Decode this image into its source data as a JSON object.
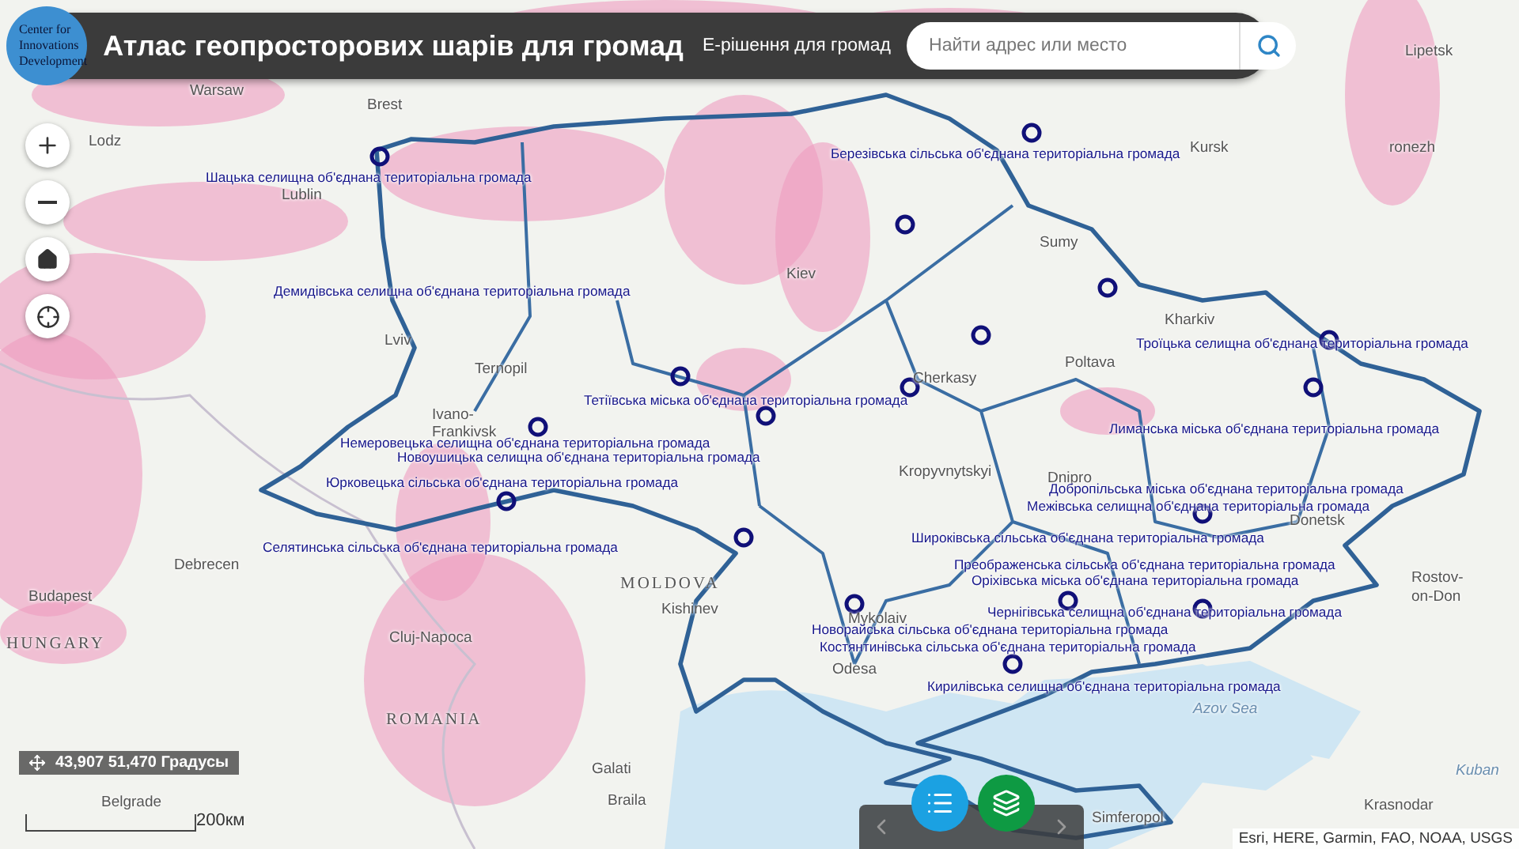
{
  "header": {
    "logo_lines": [
      "Center for",
      "Innovations",
      "Development"
    ],
    "title": "Атлас геопросторових шарів для громад",
    "subtitle": "Е-рішення для громад",
    "search": {
      "placeholder": "Найти адрес или место"
    }
  },
  "map_controls": [
    {
      "kind": "zoom-in"
    },
    {
      "kind": "zoom-out"
    },
    {
      "kind": "home"
    },
    {
      "kind": "locate"
    }
  ],
  "place_labels": [
    {
      "text": "Warsaw",
      "kind": "city"
    },
    {
      "text": "Brest",
      "kind": "city"
    },
    {
      "text": "Lodz",
      "kind": "city"
    },
    {
      "text": "Lublin",
      "kind": "city"
    },
    {
      "text": "Lipetsk",
      "kind": "city"
    },
    {
      "text": "Kursk",
      "kind": "city"
    },
    {
      "text": "ronezh",
      "kind": "city"
    },
    {
      "text": "Kiev",
      "kind": "city"
    },
    {
      "text": "Sumy",
      "kind": "city"
    },
    {
      "text": "Kharkiv",
      "kind": "city"
    },
    {
      "text": "Lviv",
      "kind": "city"
    },
    {
      "text": "Ternopil",
      "kind": "city"
    },
    {
      "text": "Ivano-",
      "kind": "city"
    },
    {
      "text": "Frankivsk",
      "kind": "city"
    },
    {
      "text": "Cherkasy",
      "kind": "city"
    },
    {
      "text": "Poltava",
      "kind": "city"
    },
    {
      "text": "Kropyvnytskyi",
      "kind": "city"
    },
    {
      "text": "Dnipro",
      "kind": "city"
    },
    {
      "text": "Donetsk",
      "kind": "city"
    },
    {
      "text": "Rostov-",
      "kind": "city"
    },
    {
      "text": "on-Don",
      "kind": "city"
    },
    {
      "text": "Mykolaiv",
      "kind": "city"
    },
    {
      "text": "Odesa",
      "kind": "city"
    },
    {
      "text": "Kishinev",
      "kind": "city"
    },
    {
      "text": "MOLDOVA",
      "kind": "country"
    },
    {
      "text": "HUNGARY",
      "kind": "country"
    },
    {
      "text": "ROMANIA",
      "kind": "country"
    },
    {
      "text": "Budapest",
      "kind": "city"
    },
    {
      "text": "Debrecen",
      "kind": "city"
    },
    {
      "text": "Cluj-Napoca",
      "kind": "city"
    },
    {
      "text": "Galati",
      "kind": "city"
    },
    {
      "text": "Belgrade",
      "kind": "city"
    },
    {
      "text": "Braila",
      "kind": "city"
    },
    {
      "text": "Krasnodar",
      "kind": "city"
    },
    {
      "text": "Simferopol",
      "kind": "city"
    },
    {
      "text": "Azov Sea",
      "kind": "water"
    },
    {
      "text": "Kuban",
      "kind": "water"
    }
  ],
  "community_labels": [
    {
      "text": "Шацька селищна об'єднана територіальна громада"
    },
    {
      "text": "Березівська сільська об'єднана територіальна громада"
    },
    {
      "text": "Демидівська селищна об'єднана територіальна громада"
    },
    {
      "text": "Троїцька селищна об'єднана територіальна громада"
    },
    {
      "text": "Тетіївська міська об'єднана територіальна громада"
    },
    {
      "text": "Лиманська міська об'єднана територіальна громада"
    },
    {
      "text": "Немеровецька селищна об'єднана територіальна громада"
    },
    {
      "text": "Новоушицька селищна об'єднана територіальна громада"
    },
    {
      "text": "Юрковецька сільська об'єднана територіальна громада"
    },
    {
      "text": "Добропільська міська об'єднана територіальна громада"
    },
    {
      "text": "Межівська селищна об'єднана територіальна громада"
    },
    {
      "text": "Широківська сільська об'єднана територіальна громада"
    },
    {
      "text": "Селятинська сільська об'єднана територіальна громада"
    },
    {
      "text": "Преображенська сільська об'єднана територіальна громада"
    },
    {
      "text": "Оріхівська міська об'єднана територіальна громада"
    },
    {
      "text": "Чернігівська селищна об'єднана територіальна громада"
    },
    {
      "text": "Новорайська сільська об'єднана територіальна громада"
    },
    {
      "text": "Костянтинівська сільська об'єднана територіальна громада"
    },
    {
      "text": "Кирилівська селищна об'єднана територіальна громада"
    }
  ],
  "coordinates": {
    "text": "43,907 51,470 Градусы"
  },
  "scale": {
    "label": "200км"
  },
  "bottom_bar": {
    "buttons": [
      {
        "kind": "list"
      },
      {
        "kind": "layers"
      }
    ]
  },
  "attribution": "Esri, HERE, Garmin, FAO, NOAA, USGS"
}
